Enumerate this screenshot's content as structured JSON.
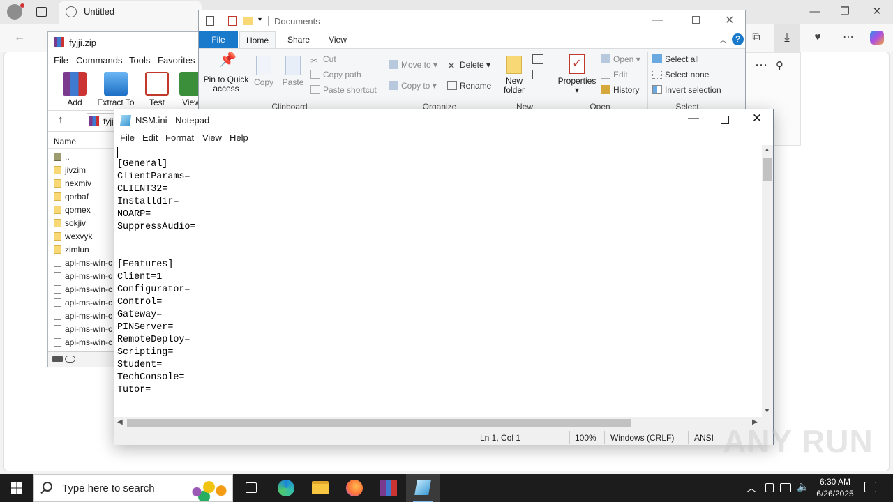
{
  "browser": {
    "tab_title": "Untitled",
    "minimize": "—",
    "restore": "❐",
    "close": "✕"
  },
  "winrar": {
    "title": "fyjji.zip",
    "menu": [
      "File",
      "Commands",
      "Tools",
      "Favorites"
    ],
    "tools": [
      "Add",
      "Extract To",
      "Test",
      "View"
    ],
    "path": "fyjji",
    "column_name": "Name",
    "rows": [
      {
        "name": "..",
        "kind": "up"
      },
      {
        "name": "jivzim",
        "kind": "folder"
      },
      {
        "name": "nexmiv",
        "kind": "folder"
      },
      {
        "name": "qorbaf",
        "kind": "folder"
      },
      {
        "name": "qornex",
        "kind": "folder"
      },
      {
        "name": "sokjiv",
        "kind": "folder"
      },
      {
        "name": "wexvyk",
        "kind": "folder"
      },
      {
        "name": "zimlun",
        "kind": "folder"
      },
      {
        "name": "api-ms-win-c",
        "kind": "file"
      },
      {
        "name": "api-ms-win-c",
        "kind": "file"
      },
      {
        "name": "api-ms-win-c",
        "kind": "file"
      },
      {
        "name": "api-ms-win-c",
        "kind": "file"
      },
      {
        "name": "api-ms-win-c",
        "kind": "file"
      },
      {
        "name": "api-ms-win-c",
        "kind": "file"
      },
      {
        "name": "api-ms-win-c",
        "kind": "file"
      }
    ]
  },
  "explorer": {
    "title": "Documents",
    "tabs": [
      "File",
      "Home",
      "Share",
      "View"
    ],
    "clipboard": {
      "pin": "Pin to Quick access",
      "copy": "Copy",
      "paste": "Paste",
      "cut": "Cut",
      "copy_path": "Copy path",
      "paste_shortcut": "Paste shortcut",
      "label": "Clipboard"
    },
    "organize": {
      "move_to": "Move to",
      "copy_to": "Copy to",
      "delete": "Delete",
      "rename": "Rename",
      "label": "Organize"
    },
    "new": {
      "new_folder": "New folder",
      "label": "New"
    },
    "open": {
      "properties": "Properties",
      "open": "Open",
      "edit": "Edit",
      "history": "History",
      "label": "Open"
    },
    "select": {
      "select_all": "Select all",
      "select_none": "Select none",
      "invert": "Invert selection",
      "label": "Select"
    }
  },
  "notepad": {
    "title": "NSM.ini - Notepad",
    "menu": [
      "File",
      "Edit",
      "Format",
      "View",
      "Help"
    ],
    "lines": [
      "",
      "[General]",
      "ClientParams=",
      "CLIENT32=",
      "Installdir=",
      "NOARP=",
      "SuppressAudio=",
      "",
      "",
      "[Features]",
      "Client=1",
      "Configurator=",
      "Control=",
      "Gateway=",
      "PINServer=",
      "RemoteDeploy=",
      "Scripting=",
      "Student=",
      "TechConsole=",
      "Tutor="
    ],
    "status": {
      "position": "Ln 1, Col 1",
      "zoom": "100%",
      "line_ending": "Windows (CRLF)",
      "encoding": "ANSI"
    }
  },
  "taskbar": {
    "search_placeholder": "Type here to search",
    "time": "6:30 AM",
    "date": "6/26/2025"
  },
  "watermark": "ANY RUN"
}
